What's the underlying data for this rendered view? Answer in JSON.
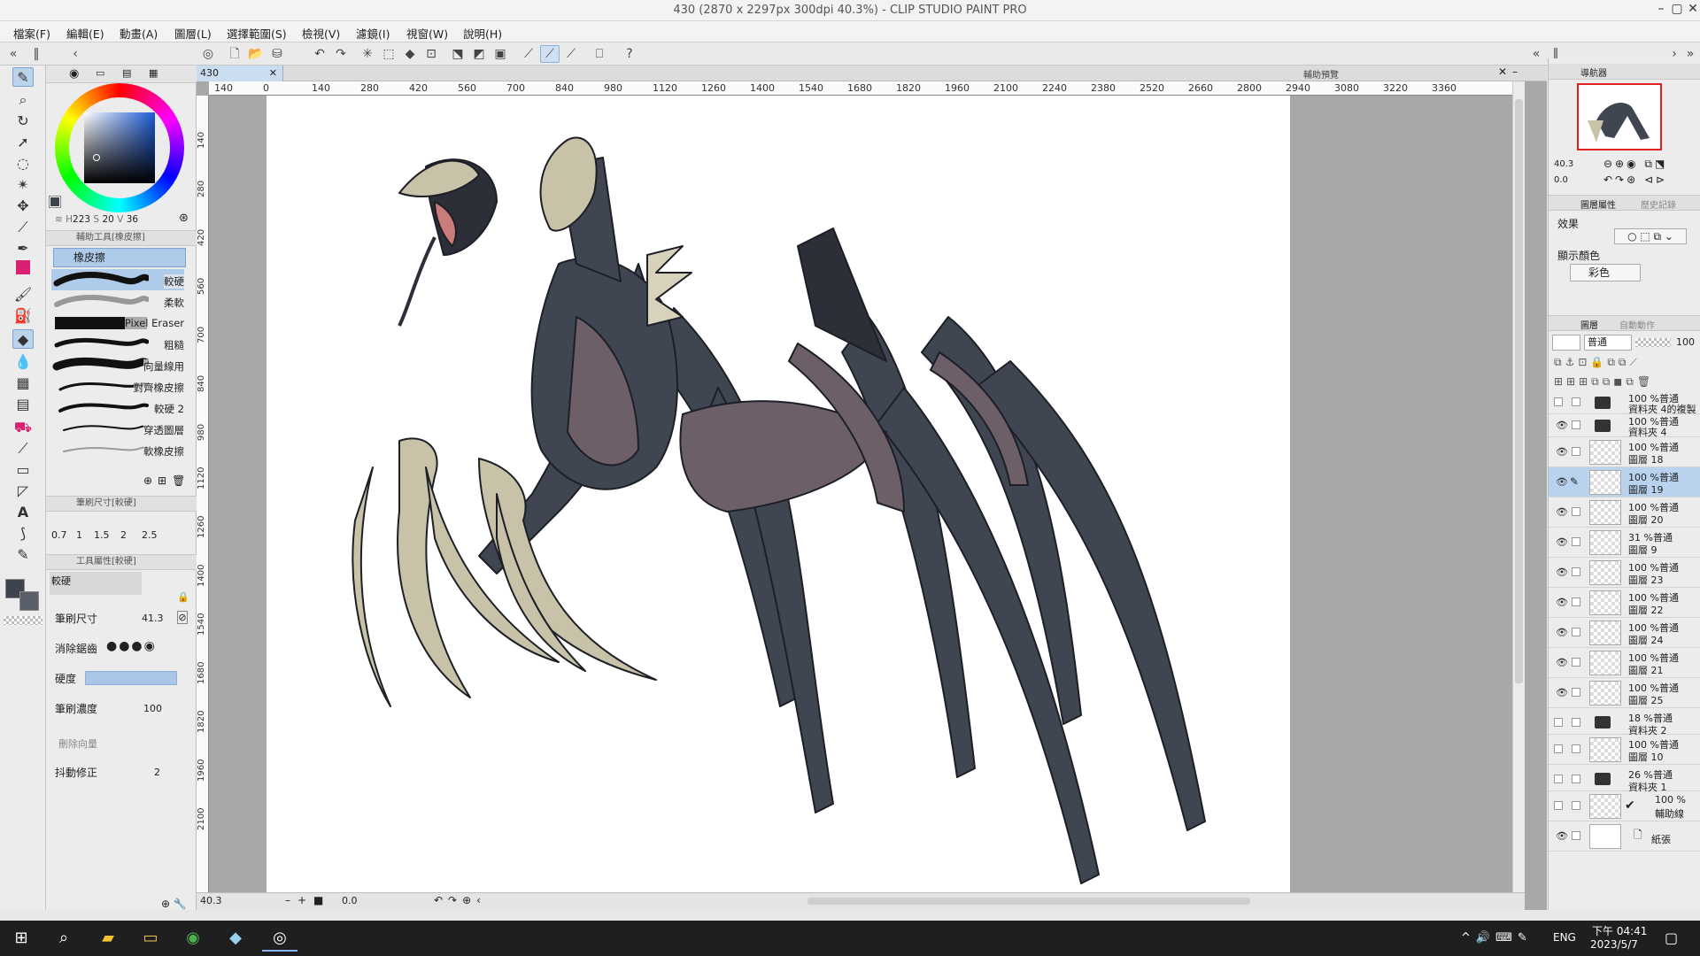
{
  "window": {
    "title": "430 (2870 x 2297px 300dpi 40.3%) - CLIP STUDIO PAINT PRO"
  },
  "menu": [
    "檔案(F)",
    "編輯(E)",
    "動畫(A)",
    "圖層(L)",
    "選擇範圍(S)",
    "檢視(V)",
    "濾鏡(I)",
    "視窗(W)",
    "說明(H)"
  ],
  "color": {
    "main": "#3e4350",
    "sub": "#5a5f6b",
    "accent": "#d81f72",
    "values": {
      "h": "223",
      "s": "20",
      "v": "36"
    }
  },
  "subtool": {
    "header": "輔助工具[橡皮擦]",
    "group": "橡皮擦",
    "items": [
      "較硬",
      "柔軟",
      "Pixel Eraser",
      "粗糙",
      "向量線用",
      "對齊橡皮擦",
      "較硬 2",
      "穿透圖層",
      "軟橡皮擦"
    ]
  },
  "brushsize": {
    "header": "筆刷尺寸[較硬]",
    "sizes": [
      "0.7",
      "1",
      "1.5",
      "2",
      "2.5"
    ]
  },
  "toolprop": {
    "header": "工具屬性[較硬]",
    "preview": "較硬",
    "size_label": "筆刷尺寸",
    "size_value": "41.3",
    "aa_label": "消除鋸齒",
    "hard_label": "硬度",
    "density_label": "筆刷濃度",
    "density_value": "100",
    "vec_label": "刪除向量",
    "stab_label": "抖動修正",
    "stab_value": "2"
  },
  "canvas": {
    "tab": "430",
    "preview_label": "輔助預覽",
    "zoom": "40.3",
    "angle": "0.0"
  },
  "ruler_top": [
    "140",
    "0",
    "140",
    "280",
    "420",
    "560",
    "700",
    "840",
    "980",
    "1120",
    "1260",
    "1400",
    "1540",
    "1680",
    "1820",
    "1960",
    "2100",
    "2240",
    "2380",
    "2520",
    "2660",
    "2800",
    "2940",
    "3080",
    "3220",
    "3360"
  ],
  "ruler_left": [
    "140",
    "280",
    "420",
    "560",
    "700",
    "840",
    "980",
    "1120",
    "1260",
    "1400",
    "1540",
    "1680",
    "1820",
    "1960",
    "2100"
  ],
  "navigator": {
    "title": "導航器",
    "zoom": "40.3",
    "angle": "0.0"
  },
  "layerprop": {
    "tab1": "圖層屬性",
    "tab2": "歷史記錄",
    "effect": "效果",
    "displaycolor": "顯示顏色",
    "colormode": "彩色"
  },
  "layerpanel": {
    "tab1": "圖層",
    "tab2": "自動動作",
    "blend": "普通",
    "opacity": "100"
  },
  "layers": [
    {
      "l1": "100 %普通",
      "l2": "資料夾 4的複製",
      "folder": true,
      "eye": false
    },
    {
      "l1": "100 %普通",
      "l2": "資料夾 4",
      "folder": true,
      "eye": true
    },
    {
      "l1": "100 %普通",
      "l2": "圖層 18",
      "folder": false,
      "eye": true
    },
    {
      "l1": "100 %普通",
      "l2": "圖層 19",
      "folder": false,
      "eye": true,
      "sel": true
    },
    {
      "l1": "100 %普通",
      "l2": "圖層 20",
      "folder": false,
      "eye": true
    },
    {
      "l1": "31 %普通",
      "l2": "圖層 9",
      "folder": false,
      "eye": true
    },
    {
      "l1": "100 %普通",
      "l2": "圖層 23",
      "folder": false,
      "eye": true
    },
    {
      "l1": "100 %普通",
      "l2": "圖層 22",
      "folder": false,
      "eye": true
    },
    {
      "l1": "100 %普通",
      "l2": "圖層 24",
      "folder": false,
      "eye": true
    },
    {
      "l1": "100 %普通",
      "l2": "圖層 21",
      "folder": false,
      "eye": true
    },
    {
      "l1": "100 %普通",
      "l2": "圖層 25",
      "folder": false,
      "eye": true
    },
    {
      "l1": "18 %普通",
      "l2": "資料夾 2",
      "folder": true,
      "eye": false
    },
    {
      "l1": "100 %普通",
      "l2": "圖層 10",
      "folder": false,
      "eye": false
    },
    {
      "l1": "26 %普通",
      "l2": "資料夾 1",
      "folder": true,
      "eye": false
    },
    {
      "l1": "100 %",
      "l2": "輔助線",
      "folder": false,
      "eye": false
    },
    {
      "l1": "",
      "l2": "紙張",
      "folder": false,
      "eye": true
    }
  ],
  "taskbar": {
    "lang": "ENG",
    "time": "下午 04:41",
    "date": "2023/5/7"
  }
}
